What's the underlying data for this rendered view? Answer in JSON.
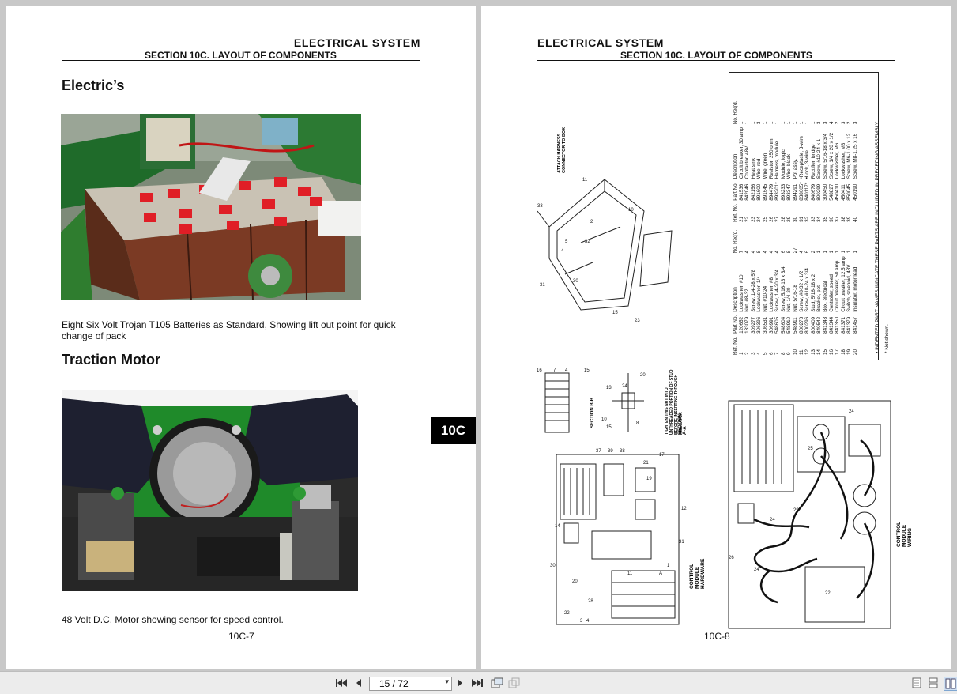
{
  "left_page": {
    "header_title": "ELECTRICAL SYSTEM",
    "header_subtitle": "SECTION 10C. LAYOUT OF COMPONENTS",
    "heading_electrics": "Electric’s",
    "caption_batteries": "Eight Six Volt Trojan T105 Batteries as Standard, Showing lift out point for quick change of pack",
    "heading_motor": "Traction Motor",
    "caption_motor": "48 Volt D.C. Motor showing sensor  for speed control.",
    "page_number": "10C-7"
  },
  "section_tab": "10C",
  "right_page": {
    "header_title": "ELECTRICAL SYSTEM",
    "header_subtitle": "SECTION 10C. LAYOUT OF COMPONENTS",
    "page_number": "10C-8",
    "diagram_labels": {
      "attach_harness": "ATTACH HARNESS CONNECTOR TO BOX",
      "section_bb": "SECTION B-B",
      "section_aa": "SECTION A-A",
      "tighten_note": "TIGHTEN THIS NUT INTO UNTHREADED PORTION OF STUD BEFORE INSERTING THROUGH INSULATOR",
      "control_module_hardware": "CONTROL MODULE HARDWARE",
      "control_module_wiring": "CONTROL MODULE WIRING"
    },
    "parts_table": {
      "headers": [
        "Ref. No.",
        "Part No.",
        "Description",
        "No. Req'd."
      ],
      "rows_left": [
        [
          "1",
          "120652",
          "Lockwasher, #10",
          "7"
        ],
        [
          "2",
          "133079",
          "Nut, #8-32",
          "4"
        ],
        [
          "3",
          "309277",
          "Screw, 1/4-28 x 5/8",
          "4"
        ],
        [
          "4",
          "306396",
          "Lockwasher, 1/4",
          "8"
        ],
        [
          "5",
          "306531",
          "Nut, #10-24",
          "4"
        ],
        [
          "6",
          "306991",
          "Lockwasher, #8",
          "4"
        ],
        [
          "7",
          "548605",
          "Screw, 1/4-20 x 3/4",
          "4"
        ],
        [
          "8",
          "548604",
          "Screw, 5/16-18 x 3/4",
          "6"
        ],
        [
          "9",
          "548910",
          "Nut, 1/4-20",
          "8"
        ],
        [
          "10",
          "548911",
          "Nut, 5/16-18",
          "27"
        ],
        [
          "11",
          "800278",
          "Screw, #8-32 x 1/2",
          "4"
        ],
        [
          "12",
          "800296",
          "Screw, #10-24 x 3/4",
          "6"
        ],
        [
          "13",
          "800409",
          "Stud, 5/16-18 x 2",
          "2"
        ],
        [
          "14",
          "840542",
          "Bracket, pot",
          "1"
        ],
        [
          "15",
          "841343",
          "Box, electrical",
          "1"
        ],
        [
          "16",
          "841344",
          "Controller, speed",
          "1"
        ],
        [
          "17",
          "841350",
          "Circuit breaker, 50 amp",
          "1"
        ],
        [
          "18",
          "841371",
          "Circuit breaker, 12.5 amp",
          "1"
        ],
        [
          "19",
          "841379",
          "Switch, solenoid, 48V",
          "1"
        ],
        [
          "20",
          "841457",
          "Insulator, motor lead",
          "1"
        ]
      ],
      "rows_right": [
        [
          "21",
          "841536",
          "Circuit breaker, 30 amp",
          "1"
        ],
        [
          "22",
          "842046",
          "Contactor, 48V",
          "1"
        ],
        [
          "23",
          "842156",
          "Heat sink",
          "1"
        ],
        [
          "24",
          "891600",
          "Wire, red",
          "3"
        ],
        [
          "25",
          "891645",
          "Wire, green",
          "1"
        ],
        [
          "26",
          "894479",
          "Resistor, 250 ohm",
          "1"
        ],
        [
          "27",
          "893201*",
          "Harness, module",
          "1"
        ],
        [
          "28",
          "893233",
          "Module, logic",
          "1"
        ],
        [
          "29",
          "893347",
          "Wire, black",
          "1"
        ],
        [
          "30",
          "894291",
          "Pot assy.",
          "1"
        ],
        [
          "31",
          "838605*",
          "•Receptacle, 3-wire",
          "1"
        ],
        [
          "32",
          "840117*",
          "•Lock, 3-wire",
          "1"
        ],
        [
          "33",
          "840679",
          "Rectifier, bridge",
          "1"
        ],
        [
          "34",
          "800299",
          "Screw, #10-24 x 1",
          "3"
        ],
        [
          "35",
          "300450",
          "Screw, 5/16-18 x 3/4",
          "3"
        ],
        [
          "36",
          "548827",
          "Screw, 1/4 x 20 x 1/2",
          "4"
        ],
        [
          "37",
          "450410",
          "Lockwasher, M6",
          "2"
        ],
        [
          "38",
          "450411",
          "Lockwasher, M8",
          "3"
        ],
        [
          "39",
          "850045",
          "Screw, M6-1.00 x 12",
          "2"
        ],
        [
          "40",
          "450190",
          "Screw, M8-1.25 x 16",
          "3"
        ]
      ],
      "footnote_1": "• INDENTED PART NAMES INDICATE THESE PARTS ARE INCLUDED IN PRECEDING ASSEMBLY.",
      "footnote_2": "* Not shown."
    }
  },
  "toolbar": {
    "page_indicator": "15 / 72",
    "icons": [
      "first-page-icon",
      "prev-page-icon",
      "page-select-dropdown-icon",
      "next-page-icon",
      "last-page-icon",
      "rotate-view-icon",
      "copy-view-icon",
      "single-page-icon",
      "continuous-page-icon",
      "facing-page-icon"
    ]
  }
}
